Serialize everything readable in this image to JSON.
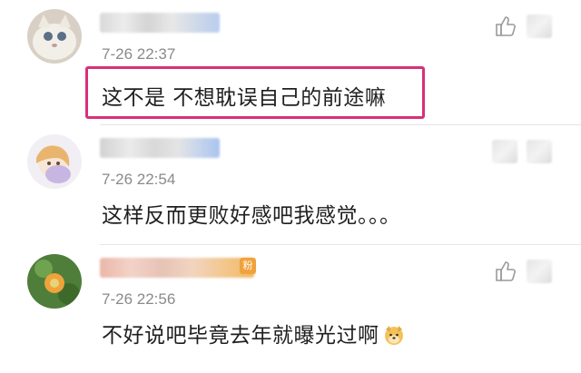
{
  "comments": [
    {
      "timestamp": "7-26 22:37",
      "text": "这不是 不想耽误自己的前途嘛",
      "highlighted": true,
      "highlight_color": "#d8307a"
    },
    {
      "timestamp": "7-26 22:54",
      "text": "这样反而更败好感吧我感觉。。。"
    },
    {
      "timestamp": "7-26 22:56",
      "text": "不好说吧毕竟去年就曝光过啊",
      "emoji": "dog-face-emoji",
      "badge": "粉"
    }
  ],
  "icons": {
    "like": "thumbs-up-icon",
    "avatar": "user-avatar"
  },
  "colors": {
    "timestamp": "#8a8a8a",
    "text": "#1f1f1f",
    "highlight": "#d8307a",
    "badge": "#f0a23c"
  }
}
